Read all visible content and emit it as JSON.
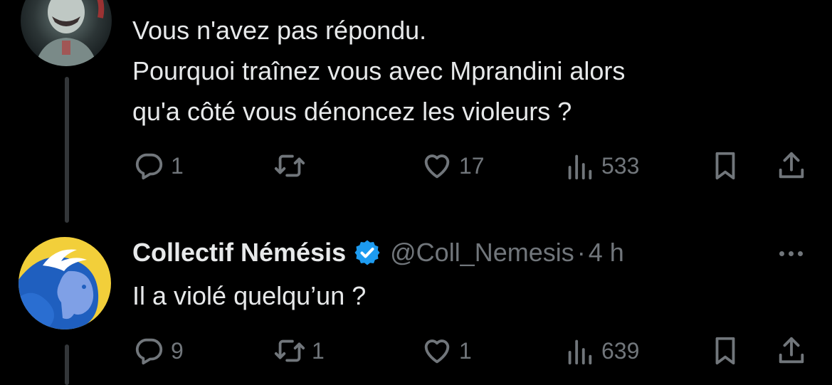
{
  "tweet1": {
    "text_lines": [
      "Vous n'avez pas répondu.",
      "Pourquoi traînez vous avec Mprandini alors",
      "qu'a côté vous dénoncez les violeurs ?"
    ],
    "actions": {
      "replies": "1",
      "reposts": "",
      "likes": "17",
      "views": "533"
    }
  },
  "tweet2": {
    "author": {
      "name": "Collectif Némésis",
      "verified": true,
      "handle": "@Coll_Nemesis",
      "separator": "·",
      "time": "4 h"
    },
    "text": "Il a violé quelqu’un ?",
    "actions": {
      "replies": "9",
      "reposts": "1",
      "likes": "1",
      "views": "639"
    }
  },
  "icons": [
    "reply-icon",
    "repost-icon",
    "like-icon",
    "views-icon",
    "bookmark-icon",
    "share-icon",
    "verified-badge-icon",
    "more-icon"
  ],
  "colors": {
    "background": "#000000",
    "text": "#e7e9ea",
    "secondary": "#71767b",
    "verified": "#1d9bf0",
    "thread_line": "#333639"
  }
}
